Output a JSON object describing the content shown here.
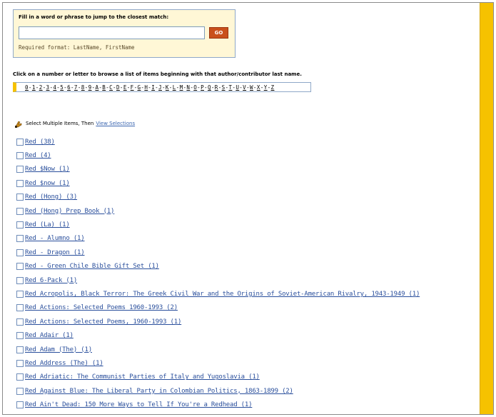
{
  "search": {
    "label": "Fill in a word or phrase to jump to the closest match:",
    "value": "",
    "button_label": "GO",
    "format_note": "Required format: LastName, FirstName"
  },
  "browse": {
    "instructions": "Click on a number or letter to browse a list of items beginning with that author/contributor last name.",
    "links": [
      "0",
      "1",
      "2",
      "3",
      "4",
      "5",
      "6",
      "7",
      "8",
      "9",
      "A",
      "B",
      "C",
      "D",
      "E",
      "F",
      "G",
      "H",
      "I",
      "J",
      "K",
      "L",
      "M",
      "N",
      "O",
      "P",
      "Q",
      "R",
      "S",
      "T",
      "U",
      "V",
      "W",
      "X",
      "Y",
      "Z"
    ]
  },
  "multi_select": {
    "text": "Select Multiple Items, Then",
    "link": "View Selections",
    "icon": "hand-pointer-icon"
  },
  "results": [
    "Red (38)",
    "Red (4)",
    "Red $Now (1)",
    "Red $now (1)",
    "Red (Hong) (3)",
    "Red (Hong) Prep Book (1)",
    "Red (La) (1)",
    "Red - Alumno (1)",
    "Red - Dragon (1)",
    "Red - Green Chile Bible Gift Set (1)",
    "Red 6-Pack (1)",
    "Red Acropolis, Black Terror: The Greek Civil War and the Origins of Soviet-American Rivalry, 1943-1949 (1)",
    "Red Actions: Selected Poems 1960-1993 (2)",
    "Red Actions: Selected Poems, 1960-1993 (1)",
    "Red Adair (1)",
    "Red Adam (The) (1)",
    "Red Address (The) (1)",
    "Red Adriatic: The Communist Parties of Italy and Yugoslavia (1)",
    "Red Against Blue: The Liberal Party in Colombian Politics, 1863-1899 (2)",
    "Red Ain't Dead: 150 More Ways to Tell If You're a Redhead (1)"
  ],
  "colors": {
    "accent_gold": "#f6c200",
    "go_button": "#c9501c",
    "link_blue": "#2a4f9c"
  }
}
